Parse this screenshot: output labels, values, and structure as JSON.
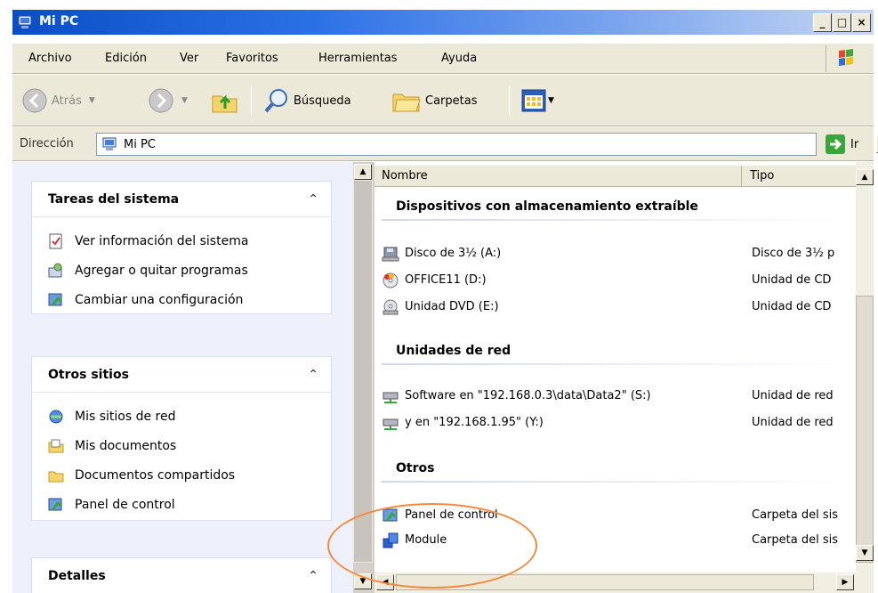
{
  "window": {
    "title": "Mi PC",
    "minimize": "_",
    "maximize": "□",
    "close": "×"
  },
  "menu": [
    "Archivo",
    "Edición",
    "Ver",
    "Favoritos",
    "Herramientas",
    "Ayuda"
  ],
  "toolbar": {
    "back": "Atrás",
    "search": "Búsqueda",
    "folders": "Carpetas"
  },
  "address": {
    "label": "Dirección",
    "value": "Mi PC",
    "go": "Ir"
  },
  "panels": [
    {
      "title": "Tareas del sistema",
      "items": [
        "Ver información del sistema",
        "Agregar o quitar programas",
        "Cambiar una configuración"
      ]
    },
    {
      "title": "Otros sitios",
      "items": [
        "Mis sitios de red",
        "Mis documentos",
        "Documentos compartidos",
        "Panel de control"
      ]
    },
    {
      "title": "Detalles",
      "items": []
    }
  ],
  "columns": {
    "name": "Nombre",
    "type": "Tipo"
  },
  "groups": [
    {
      "title": "Dispositivos con almacenamiento extraíble",
      "items": [
        {
          "name": "Disco de 3½ (A:)",
          "type": "Disco de 3½ p",
          "icon": "floppy-icon"
        },
        {
          "name": "OFFICE11 (D:)",
          "type": "Unidad de CD",
          "icon": "cd-icon"
        },
        {
          "name": "Unidad DVD (E:)",
          "type": "Unidad de CD",
          "icon": "dvd-icon"
        }
      ]
    },
    {
      "title": "Unidades de red",
      "items": [
        {
          "name": "Software en \"192.168.0.3\\data\\Data2\" (S:)",
          "type": "Unidad de red",
          "icon": "network-drive-icon"
        },
        {
          "name": "y en \"192.168.1.95\" (Y:)",
          "type": "Unidad de red",
          "icon": "network-drive-icon"
        }
      ]
    },
    {
      "title": "Otros",
      "items": [
        {
          "name": "Panel de control",
          "type": "Carpeta del sis",
          "icon": "control-panel-icon"
        },
        {
          "name": "Module",
          "type": "Carpeta del sis",
          "icon": "module-icon"
        }
      ]
    }
  ],
  "colors": {
    "titlebar": "#0a4ec4",
    "annotation": "#f58a3c",
    "pane": "#eef1fb"
  }
}
